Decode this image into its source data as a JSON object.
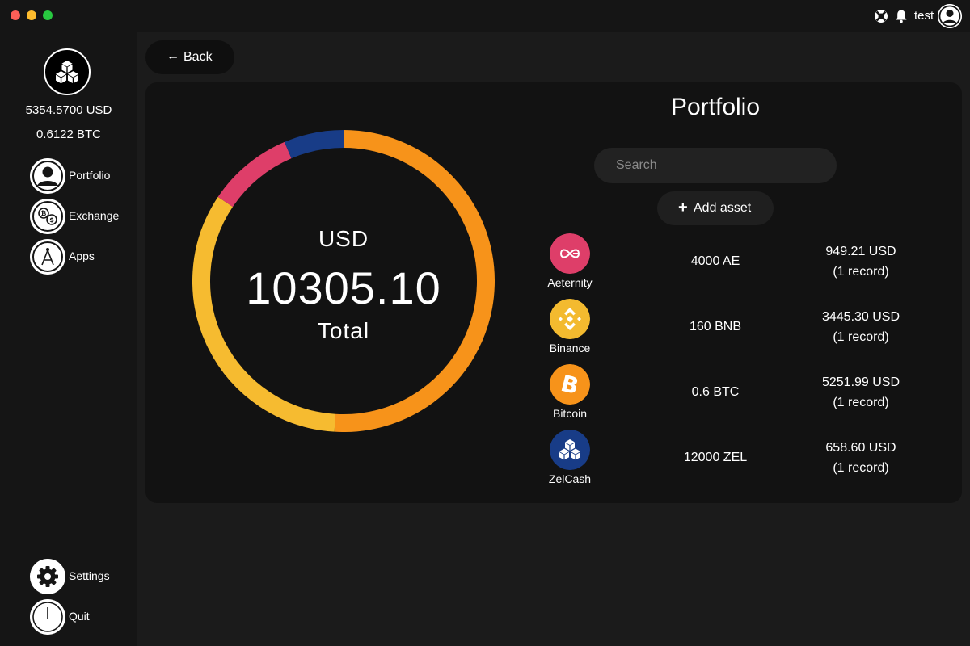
{
  "titlebar": {
    "username": "test"
  },
  "sidebar": {
    "balance_usd": "5354.5700 USD",
    "balance_btc": "0.6122 BTC",
    "nav": [
      {
        "label": "Portfolio",
        "icon": "user-icon"
      },
      {
        "label": "Exchange",
        "icon": "exchange-icon"
      },
      {
        "label": "Apps",
        "icon": "apps-icon"
      }
    ],
    "settings_label": "Settings",
    "quit_label": "Quit"
  },
  "back_label": "Back",
  "portfolio": {
    "title": "Portfolio",
    "search_placeholder": "Search",
    "add_asset_label": "Add asset",
    "chart": {
      "currency": "USD",
      "total": "10305.10",
      "total_label": "Total"
    },
    "assets": [
      {
        "name": "Aeternity",
        "amount": "4000 AE",
        "value": "949.21 USD",
        "records": "(1 record)",
        "color": "#de3e69"
      },
      {
        "name": "Binance",
        "amount": "160 BNB",
        "value": "3445.30 USD",
        "records": "(1 record)",
        "color": "#f3ba2f"
      },
      {
        "name": "Bitcoin",
        "amount": "0.6 BTC",
        "value": "5251.99 USD",
        "records": "(1 record)",
        "color": "#f7931a"
      },
      {
        "name": "ZelCash",
        "amount": "12000 ZEL",
        "value": "658.60 USD",
        "records": "(1 record)",
        "color": "#183c87"
      }
    ]
  },
  "chart_data": {
    "type": "pie",
    "categories": [
      "Bitcoin",
      "Binance",
      "Aeternity",
      "ZelCash"
    ],
    "values": [
      5251.99,
      3445.3,
      949.21,
      658.6
    ],
    "colors": [
      "#f7931a",
      "#f6bb30",
      "#de3e69",
      "#183c87"
    ],
    "title": "",
    "unit": "USD"
  }
}
